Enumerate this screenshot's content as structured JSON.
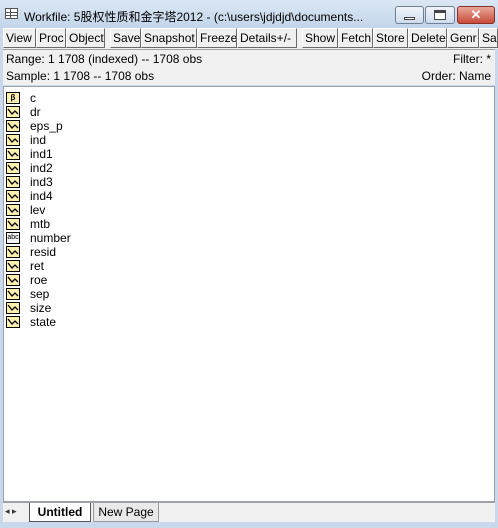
{
  "window": {
    "title": "Workfile: 5股权性质和金字塔2012 - (c:\\users\\jdjdjd\\documents...",
    "close_glyph": "✕"
  },
  "toolbar": {
    "buttons": [
      "View",
      "Proc",
      "Object",
      "Save",
      "Snapshot",
      "Freeze",
      "Details+/-",
      "Show",
      "Fetch",
      "Store",
      "Delete",
      "Genr",
      "Sa"
    ]
  },
  "info": {
    "range": "Range:  1 1708 (indexed)  --   1708 obs",
    "filter": "Filter: *",
    "sample": "Sample: 1 1708  --   1708 obs",
    "order": "Order: Name"
  },
  "objects": [
    {
      "name": "c",
      "icon": "coef-icon",
      "glyph": "β"
    },
    {
      "name": "dr",
      "icon": "series-icon"
    },
    {
      "name": "eps_p",
      "icon": "series-icon"
    },
    {
      "name": "ind",
      "icon": "series-icon"
    },
    {
      "name": "ind1",
      "icon": "series-icon"
    },
    {
      "name": "ind2",
      "icon": "series-icon"
    },
    {
      "name": "ind3",
      "icon": "series-icon"
    },
    {
      "name": "ind4",
      "icon": "series-icon"
    },
    {
      "name": "lev",
      "icon": "series-icon"
    },
    {
      "name": "mtb",
      "icon": "series-icon"
    },
    {
      "name": "number",
      "icon": "alpha-icon",
      "glyph": "abc"
    },
    {
      "name": "resid",
      "icon": "series-icon"
    },
    {
      "name": "ret",
      "icon": "series-icon"
    },
    {
      "name": "roe",
      "icon": "series-icon"
    },
    {
      "name": "sep",
      "icon": "series-icon"
    },
    {
      "name": "size",
      "icon": "series-icon"
    },
    {
      "name": "state",
      "icon": "series-icon"
    }
  ],
  "tabs": {
    "nav": "◂ ▸",
    "items": [
      "Untitled",
      "New Page"
    ]
  }
}
